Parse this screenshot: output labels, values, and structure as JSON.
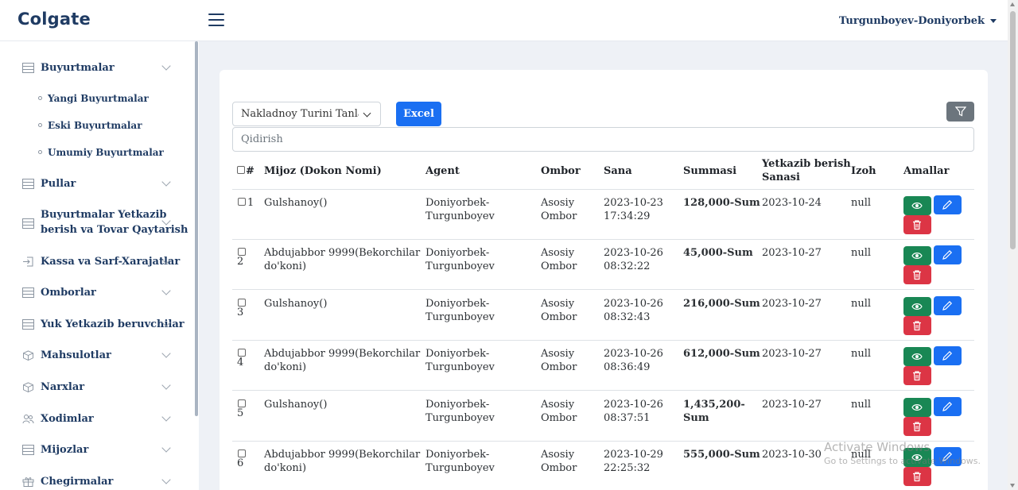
{
  "header": {
    "brand": "Colgate",
    "user": "Turgunboyev-Doniyorbek"
  },
  "sidebar": {
    "items": [
      {
        "label": "Buyurtmalar",
        "icon": "stack-icon"
      },
      {
        "label": "Pullar",
        "icon": "stack-icon"
      },
      {
        "label": "Buyurtmalar Yetkazib",
        "label2": "berish va Tovar Qaytarish",
        "icon": "stack-icon"
      },
      {
        "label": "Kassa va Sarf-Xarajatlar",
        "icon": "login-icon"
      },
      {
        "label": "Omborlar",
        "icon": "stack-icon"
      },
      {
        "label": "Yuk Yetkazib beruvchilar",
        "icon": "stack-icon"
      },
      {
        "label": "Mahsulotlar",
        "icon": "box-icon"
      },
      {
        "label": "Narxlar",
        "icon": "box-icon"
      },
      {
        "label": "Xodimlar",
        "icon": "people-icon"
      },
      {
        "label": "Mijozlar",
        "icon": "stack-icon"
      },
      {
        "label": "Chegirmalar",
        "icon": "gift-icon"
      }
    ],
    "subitems": [
      "Yangi Buyurtmalar",
      "Eski Buyurtmalar",
      "Umumiy Buyurtmalar"
    ]
  },
  "toolbar": {
    "select_value": "Nakladnoy Turini Tanlang",
    "excel_label": "Excel",
    "search_placeholder": "Qidirish"
  },
  "table": {
    "headers": {
      "num": "#",
      "client": "Mijoz (Dokon Nomi)",
      "agent": "Agent",
      "warehouse": "Ombor",
      "date": "Sana",
      "sum": "Summasi",
      "delivery1": "Yetkazib berish",
      "delivery2": "Sanasi",
      "note": "Izoh",
      "actions": "Amallar"
    },
    "rows": [
      {
        "num": "1",
        "client1": "Gulshanoy()",
        "client2": "",
        "agent1": "Doniyorbek-",
        "agent2": "Turgunboyev",
        "wh1": "Asosiy",
        "wh2": "Ombor",
        "date1": "2023-10-23",
        "date2": "17:34:29",
        "sum1": "128,000-Sum",
        "sum2": "",
        "delivery": "2023-10-24",
        "note": "null"
      },
      {
        "num": "2",
        "client1": "Abdujabbor 9999(Bekorchilar",
        "client2": "do'koni)",
        "agent1": "Doniyorbek-",
        "agent2": "Turgunboyev",
        "wh1": "Asosiy",
        "wh2": "Ombor",
        "date1": "2023-10-26",
        "date2": "08:32:22",
        "sum1": "45,000-Sum",
        "sum2": "",
        "delivery": "2023-10-27",
        "note": "null"
      },
      {
        "num": "3",
        "client1": "Gulshanoy()",
        "client2": "",
        "agent1": "Doniyorbek-",
        "agent2": "Turgunboyev",
        "wh1": "Asosiy",
        "wh2": "Ombor",
        "date1": "2023-10-26",
        "date2": "08:32:43",
        "sum1": "216,000-Sum",
        "sum2": "",
        "delivery": "2023-10-27",
        "note": "null"
      },
      {
        "num": "4",
        "client1": "Abdujabbor 9999(Bekorchilar",
        "client2": "do'koni)",
        "agent1": "Doniyorbek-",
        "agent2": "Turgunboyev",
        "wh1": "Asosiy",
        "wh2": "Ombor",
        "date1": "2023-10-26",
        "date2": "08:36:49",
        "sum1": "612,000-Sum",
        "sum2": "",
        "delivery": "2023-10-27",
        "note": "null"
      },
      {
        "num": "5",
        "client1": "Gulshanoy()",
        "client2": "",
        "agent1": "Doniyorbek-",
        "agent2": "Turgunboyev",
        "wh1": "Asosiy",
        "wh2": "Ombor",
        "date1": "2023-10-26",
        "date2": "08:37:51",
        "sum1": "1,435,200-",
        "sum2": "Sum",
        "delivery": "2023-10-27",
        "note": "null"
      },
      {
        "num": "6",
        "client1": "Abdujabbor 9999(Bekorchilar",
        "client2": "do'koni)",
        "agent1": "Doniyorbek-",
        "agent2": "Turgunboyev",
        "wh1": "Asosiy",
        "wh2": "Ombor",
        "date1": "2023-10-29",
        "date2": "22:25:32",
        "sum1": "555,000-Sum",
        "sum2": "",
        "delivery": "2023-10-30",
        "note": "null"
      }
    ]
  },
  "watermark": {
    "line1": "Activate Windows",
    "line2": "Go to Settings to activate Windows."
  }
}
